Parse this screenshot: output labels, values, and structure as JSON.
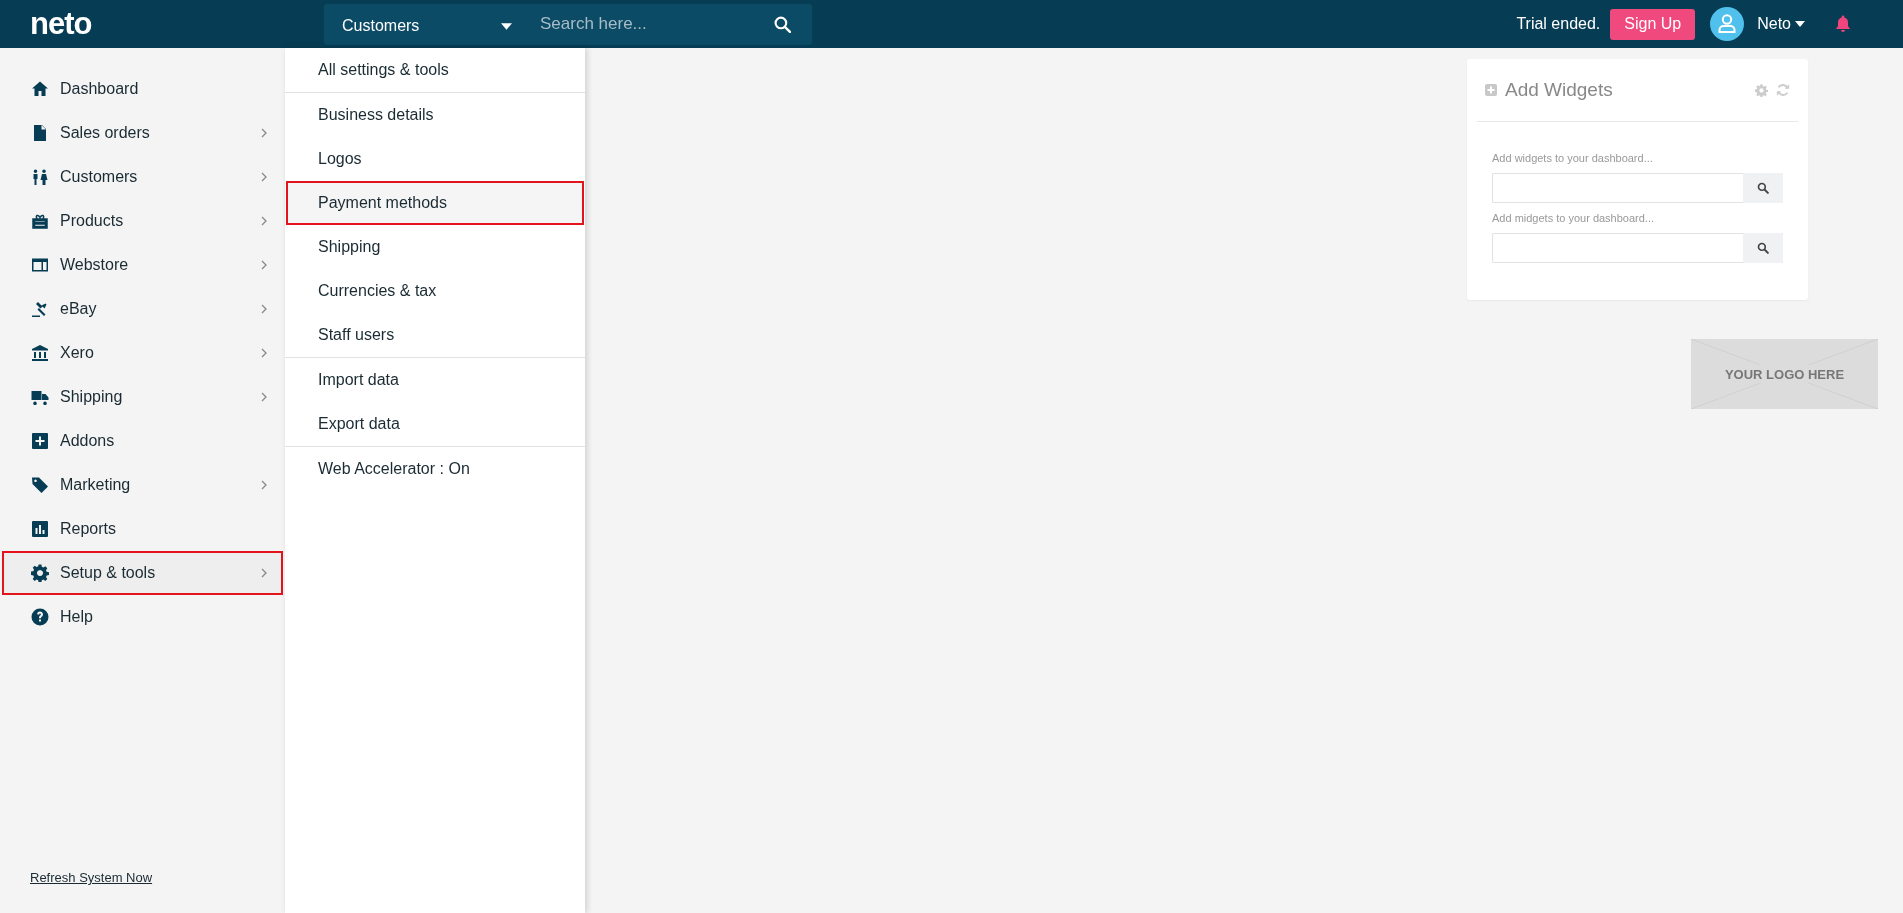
{
  "topbar": {
    "logo": "neto",
    "search_scope": "Customers",
    "search": {
      "placeholder": "Search here..."
    },
    "trial_text": "Trial ended.",
    "signup_button": "Sign Up",
    "user_name": "Neto"
  },
  "sidebar": {
    "items": [
      {
        "label": "Dashboard",
        "submenu": false,
        "selected": false
      },
      {
        "label": "Sales orders",
        "submenu": true,
        "selected": false
      },
      {
        "label": "Customers",
        "submenu": true,
        "selected": false
      },
      {
        "label": "Products",
        "submenu": true,
        "selected": false
      },
      {
        "label": "Webstore",
        "submenu": true,
        "selected": false
      },
      {
        "label": "eBay",
        "submenu": true,
        "selected": false
      },
      {
        "label": "Xero",
        "submenu": true,
        "selected": false
      },
      {
        "label": "Shipping",
        "submenu": true,
        "selected": false
      },
      {
        "label": "Addons",
        "submenu": false,
        "selected": false
      },
      {
        "label": "Marketing",
        "submenu": true,
        "selected": false
      },
      {
        "label": "Reports",
        "submenu": false,
        "selected": false
      },
      {
        "label": "Setup & tools",
        "submenu": true,
        "selected": true
      },
      {
        "label": "Help",
        "submenu": false,
        "selected": false
      }
    ],
    "footer_link": "Refresh System Now"
  },
  "setup_menu": {
    "groups": [
      {
        "items": [
          {
            "label": "All settings & tools",
            "selected": false
          }
        ]
      },
      {
        "items": [
          {
            "label": "Business details",
            "selected": false
          },
          {
            "label": "Logos",
            "selected": false
          },
          {
            "label": "Payment methods",
            "selected": true
          },
          {
            "label": "Shipping",
            "selected": false
          },
          {
            "label": "Currencies & tax",
            "selected": false
          },
          {
            "label": "Staff users",
            "selected": false
          }
        ]
      },
      {
        "items": [
          {
            "label": "Import data",
            "selected": false
          },
          {
            "label": "Export data",
            "selected": false
          }
        ]
      },
      {
        "items": [
          {
            "label": "Web Accelerator : On",
            "selected": false
          }
        ]
      }
    ]
  },
  "widgets_panel": {
    "title": "Add Widgets",
    "fields": [
      {
        "label": "Add widgets to your dashboard..."
      },
      {
        "label": "Add midgets to your dashboard..."
      }
    ]
  },
  "logo_placeholder": "YOUR LOGO HERE"
}
